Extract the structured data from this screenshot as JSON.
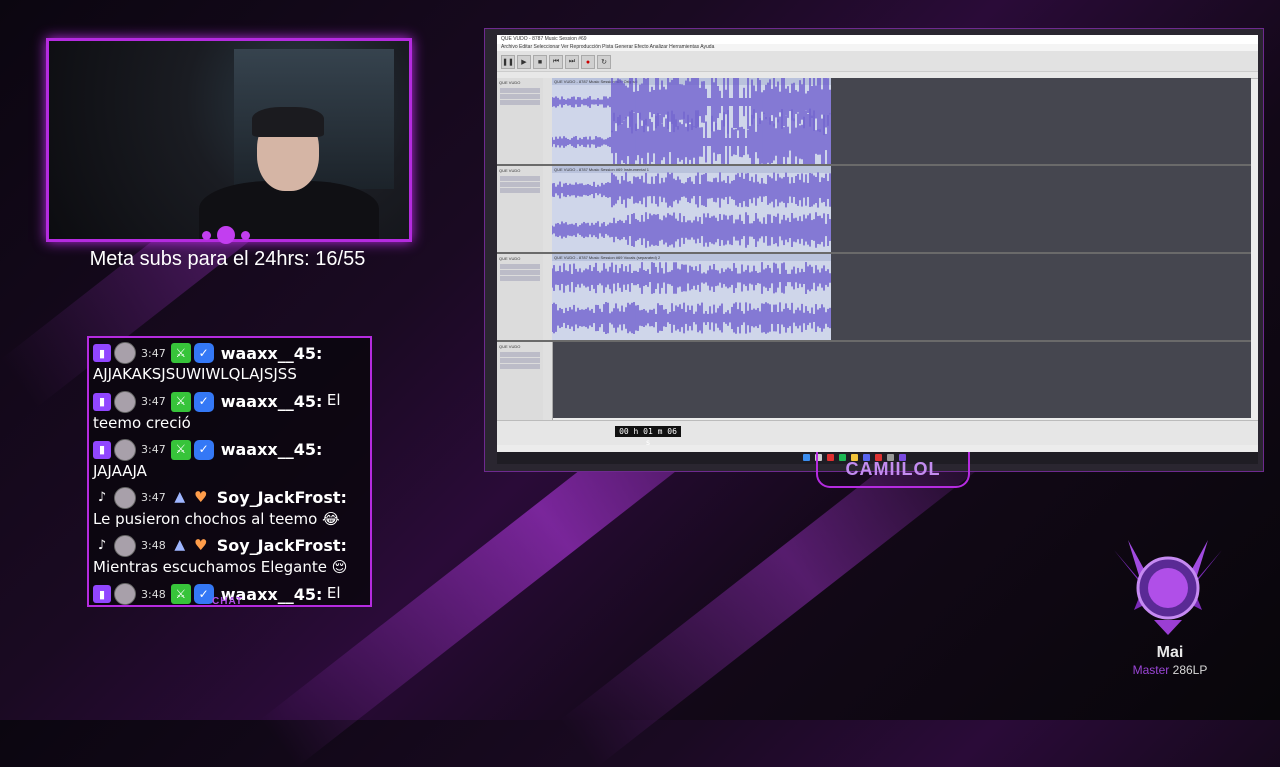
{
  "overlay": {
    "subs_goal": "Meta subs para el 24hrs: 16/55",
    "chat_label": "CHAT",
    "channel_name": "CAMIILOL"
  },
  "chat": {
    "messages": [
      {
        "platform": "twitch",
        "time": "3:47",
        "user": "waaxx__45:",
        "text": "AJJAKAKSJSUWIWLQLAJSJSS"
      },
      {
        "platform": "twitch",
        "time": "3:47",
        "user": "waaxx__45:",
        "text": "El teemo creció"
      },
      {
        "platform": "twitch",
        "time": "3:47",
        "user": "waaxx__45:",
        "text": "JAJAAJA"
      },
      {
        "platform": "tiktok",
        "time": "3:47",
        "user": "Soy_JackFrost:",
        "text": "Le pusieron chochos al teemo 😂"
      },
      {
        "platform": "tiktok",
        "time": "3:48",
        "user": "Soy_JackFrost:",
        "text": "Mientras escuchamos Elegante 😌"
      },
      {
        "platform": "twitch",
        "time": "3:48",
        "user": "waaxx__45:",
        "text": "El"
      }
    ]
  },
  "audacity": {
    "title": "QUE VUDO - 8787 Music Session #69",
    "menu": "Archivo  Editar  Seleccionar  Ver  Reproducción  Pista  Generar  Efecto  Analizar  Herramientas  Ayuda",
    "tracks": [
      {
        "name": "QUE VUDO - 8787 Music Session #69 Original"
      },
      {
        "name": "QUE VUDO - 8787 Music Session #69 Instrumental 1"
      },
      {
        "name": "QUE VUDO - 8787 Music Session #69 Vocals (separated) 2"
      },
      {
        "name": ""
      }
    ],
    "track_label": "QUE VUDO",
    "clock": "00 h 01 m 06 s"
  },
  "rank": {
    "name": "Mai",
    "tier": "Master",
    "lp": "286LP"
  },
  "colors": {
    "accent": "#b52be0",
    "waveform": "#6a5acd"
  }
}
